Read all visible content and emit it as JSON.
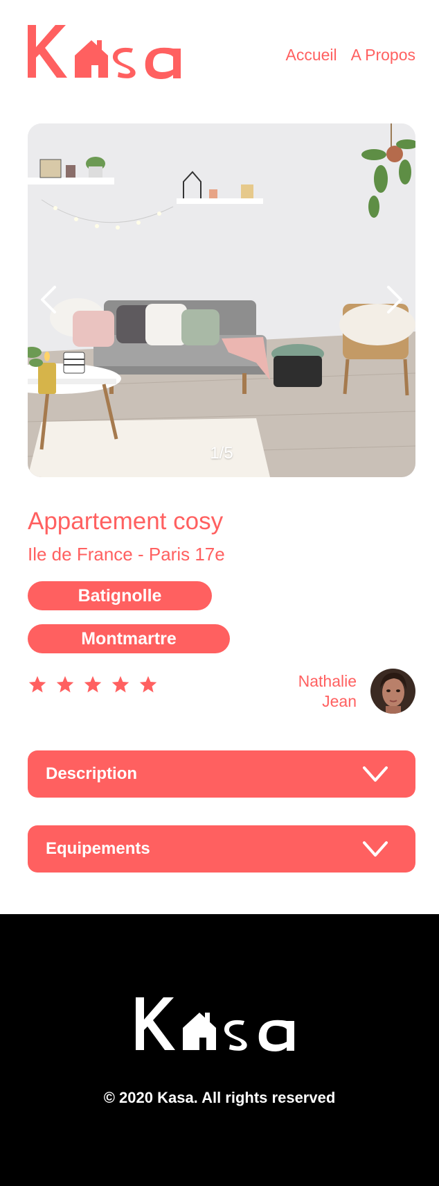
{
  "brand": {
    "name": "Kasa",
    "accent_color": "#FF6060",
    "footer_bg": "#000000"
  },
  "nav": {
    "items": [
      {
        "label": "Accueil"
      },
      {
        "label": "A Propos"
      }
    ]
  },
  "carousel": {
    "counter": "1/5",
    "current_index": 1,
    "total": 5,
    "prev_icon": "chevron-left-icon",
    "next_icon": "chevron-right-icon"
  },
  "listing": {
    "title": "Appartement cosy",
    "location": "Ile de France - Paris 17e",
    "tags": [
      "Batignolle",
      "Montmartre"
    ],
    "rating": 5,
    "rating_max": 5
  },
  "host": {
    "first_name": "Nathalie",
    "last_name": "Jean"
  },
  "collapses": [
    {
      "label": "Description",
      "icon": "chevron-down-icon"
    },
    {
      "label": "Equipements",
      "icon": "chevron-down-icon"
    }
  ],
  "footer": {
    "copyright": "© 2020 Kasa. All rights reserved"
  }
}
